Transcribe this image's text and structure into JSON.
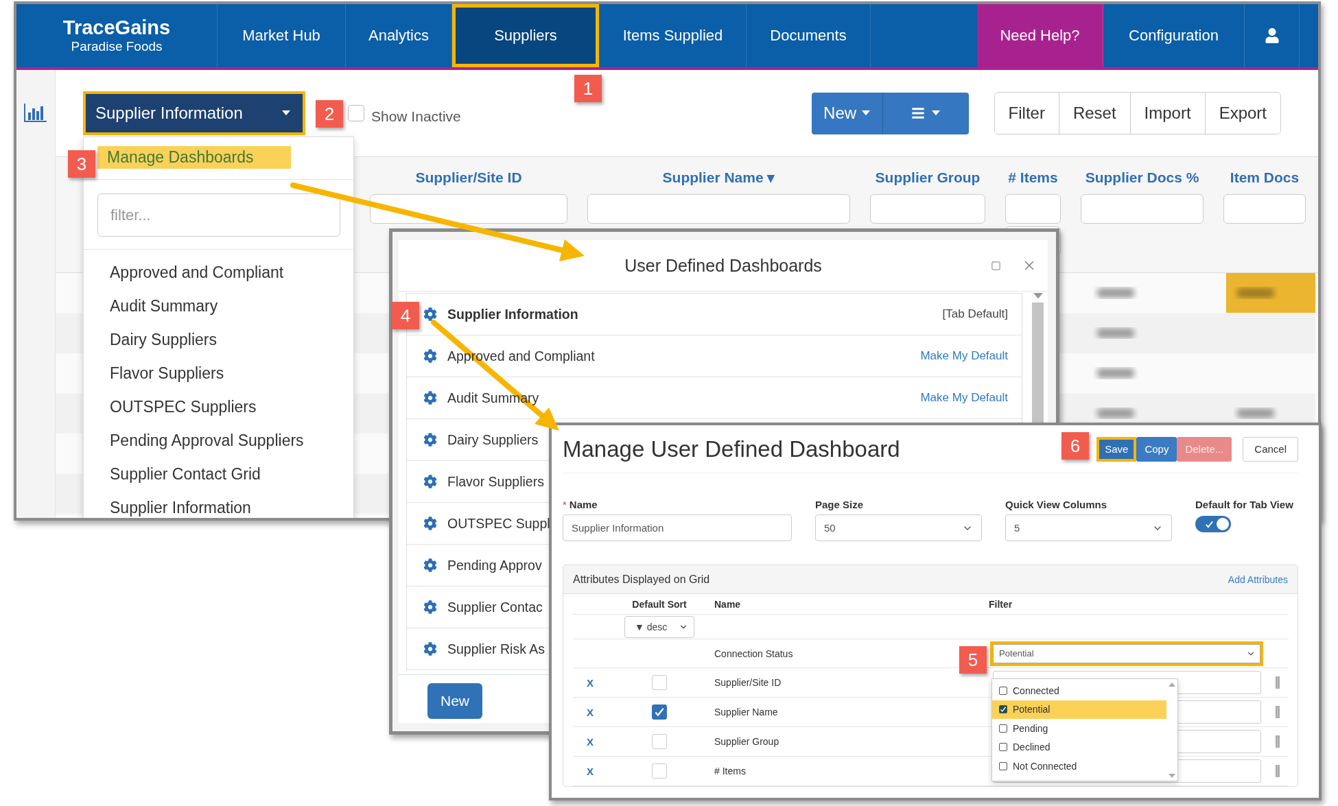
{
  "app": {
    "logo": {
      "title": "TraceGains",
      "subtitle": "Paradise Foods"
    },
    "nav": [
      {
        "label": "Market Hub",
        "selected": false
      },
      {
        "label": "Analytics",
        "selected": false
      },
      {
        "label": "Suppliers",
        "selected": true
      },
      {
        "label": "Items Supplied",
        "selected": false
      },
      {
        "label": "Documents",
        "selected": false
      }
    ],
    "nav_right": [
      {
        "label": "Need Help?",
        "kind": "help"
      },
      {
        "label": "Configuration",
        "kind": "link"
      },
      {
        "kind": "user"
      }
    ],
    "dashboard_button": {
      "label": "Supplier Information"
    },
    "show_inactive": {
      "label": "Show Inactive",
      "checked": false
    },
    "new_button": {
      "label": "New"
    },
    "actions": [
      "Filter",
      "Reset",
      "Import",
      "Export"
    ],
    "columns": [
      {
        "label": "Supplier/Site ID"
      },
      {
        "label": "Supplier Name ▾"
      },
      {
        "label": "Supplier Group"
      },
      {
        "label": "# Items",
        "extra_filter": true
      },
      {
        "label": "Supplier Docs %"
      },
      {
        "label": "Item Docs"
      }
    ],
    "dashboard_menu": {
      "manage": "Manage Dashboards",
      "filter_placeholder": "filter...",
      "items": [
        "Approved and Compliant",
        "Audit Summary",
        "Dairy Suppliers",
        "Flavor Suppliers",
        "OUTSPEC Suppliers",
        "Pending Approval Suppliers",
        "Supplier Contact Grid",
        "Supplier Information"
      ]
    }
  },
  "dashboards_dialog": {
    "title": "User Defined Dashboards",
    "items": [
      {
        "name": "Supplier Information",
        "kind": "default",
        "note": "[Tab Default]"
      },
      {
        "name": "Approved and Compliant",
        "kind": "other",
        "link": "Make My Default"
      },
      {
        "name": "Audit Summary",
        "kind": "other",
        "link": "Make My Default"
      },
      {
        "name": "Dairy Suppliers",
        "kind": "other"
      },
      {
        "name": "Flavor Suppliers",
        "kind": "other"
      },
      {
        "name": "OUTSPEC Suppl",
        "kind": "other"
      },
      {
        "name": "Pending Approv",
        "kind": "other"
      },
      {
        "name": "Supplier Contac",
        "kind": "other"
      },
      {
        "name": "Supplier Risk As",
        "kind": "other"
      }
    ],
    "new_button": "New"
  },
  "manage_dialog": {
    "title": "Manage User Defined Dashboard",
    "buttons": [
      {
        "label": "Save",
        "kind": "primary"
      },
      {
        "label": "Copy",
        "kind": "secondary"
      },
      {
        "label": "Delete...",
        "kind": "danger"
      },
      {
        "label": "Cancel",
        "kind": "plain"
      }
    ],
    "name_field": {
      "label": "Name",
      "required_mark": "*",
      "value": "Supplier Information"
    },
    "page_size": {
      "label": "Page Size",
      "value": "50"
    },
    "quick_view": {
      "label": "Quick View Columns",
      "value": "5"
    },
    "default_tab": {
      "label": "Default for Tab View",
      "on": true
    },
    "attributes": {
      "title": "Attributes Displayed on Grid",
      "add_link": "Add Attributes",
      "headers": [
        "Default Sort",
        "Name",
        "Filter"
      ],
      "sort_value": "▼ desc"
    },
    "rows": [
      {
        "name": "Connection Status",
        "kind": "status",
        "filter": "Potential"
      },
      {
        "name": "Supplier/Site ID",
        "kind": "attribute",
        "remove": "X",
        "default_sort": false
      },
      {
        "name": "Supplier Name",
        "kind": "attribute",
        "remove": "X",
        "default_sort": true
      },
      {
        "name": "Supplier Group",
        "kind": "attribute",
        "remove": "X",
        "default_sort": false
      },
      {
        "name": "# Items",
        "kind": "attribute",
        "remove": "X",
        "default_sort": false
      }
    ],
    "filter_options": [
      {
        "label": "Connected",
        "checked": false
      },
      {
        "label": "Potential",
        "checked": true
      },
      {
        "label": "Pending",
        "checked": false
      },
      {
        "label": "Declined",
        "checked": false
      },
      {
        "label": "Not Connected",
        "checked": false
      }
    ]
  },
  "callouts": [
    "1",
    "2",
    "3",
    "4",
    "5",
    "6"
  ]
}
